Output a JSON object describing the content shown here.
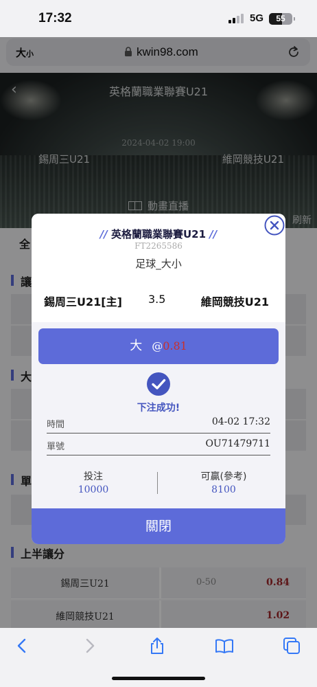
{
  "status_bar": {
    "time": "17:32",
    "network": "5G",
    "battery": "55",
    "battery_level": 0.55
  },
  "browser": {
    "text_size_label": "大",
    "text_size_small": "小",
    "url": "kwin98.com"
  },
  "match": {
    "league": "英格蘭職業聯賽U21",
    "datetime": "2024-04-02 19:00",
    "home": "錫周三U21",
    "away": "維岡競技U21",
    "live_label": "動畫直播",
    "refresh_label": "刷新"
  },
  "background_page": {
    "tab_all": "全",
    "section_handicap": "讓",
    "section_overunder": "大",
    "section_oddeven": "單",
    "section_first_half_handicap": "上半讓分",
    "rows": [
      {
        "team": "錫周三U21",
        "line": "0-50",
        "odds": "0.84"
      },
      {
        "team": "維岡競技U21",
        "line": "",
        "odds": "1.02"
      }
    ]
  },
  "bet_modal": {
    "league": "英格蘭職業聯賽U21",
    "slash_left": "//",
    "slash_right": "//",
    "ticket_code": "FT2265586",
    "market": "足球_大小",
    "home": "錫周三U21[主]",
    "line": "3.5",
    "away": "維岡競技U21",
    "pick": "大",
    "at_sign": "@",
    "odds": "0.81",
    "success_text": "下注成功!",
    "time_label": "時間",
    "time_value": "04-02 17:32",
    "order_label": "單號",
    "order_value": "OU71479711",
    "stake_label": "投注",
    "stake_value": "10000",
    "win_label": "可贏(參考)",
    "win_value": "8100",
    "close_label": "關閉"
  },
  "colors": {
    "accent": "#5d6bd9",
    "odds_red": "#c9302c",
    "success_blue": "#4455bf"
  }
}
